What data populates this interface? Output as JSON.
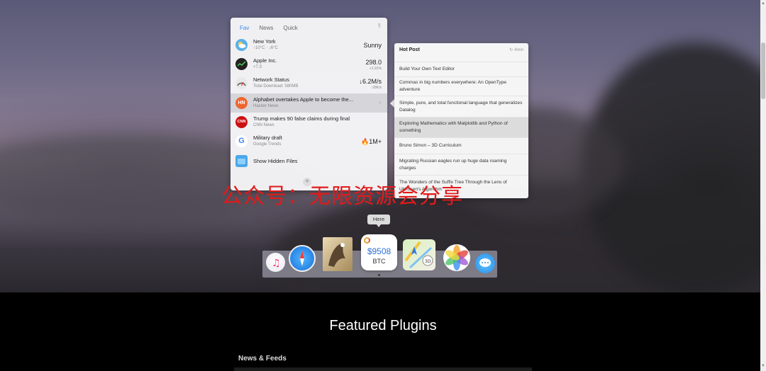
{
  "widget": {
    "tabs": [
      "Fav",
      "News",
      "Quick"
    ],
    "rows": [
      {
        "title": "New York",
        "subtitle": "↑10°C · ↓6°C",
        "value": "Sunny",
        "icon": "weather-icon"
      },
      {
        "title": "Apple Inc.",
        "subtitle": "+7.3",
        "value": "298.0",
        "value_sub": "+1.91%",
        "icon": "stock-icon"
      },
      {
        "title": "Network Status",
        "subtitle": "Total Download: 580MB",
        "value": "↓6.2M/s",
        "value_sub": "↑28K/s",
        "icon": "network-icon"
      },
      {
        "title": "Alphabet overtakes Apple to become the...",
        "subtitle": "Hacker News",
        "icon": "hacker-news-icon"
      },
      {
        "title": "Trump makes 90 false claims during final",
        "subtitle": "CNN News",
        "icon": "cnn-icon"
      },
      {
        "title": "Military draft",
        "subtitle": "Google Trends",
        "value": "🔥1M+",
        "icon": "google-icon"
      },
      {
        "title": "Show Hidden Files",
        "icon": "finder-icon"
      }
    ],
    "add_label": "+"
  },
  "hot_post": {
    "title": "Hot Post",
    "time": "4min",
    "posts": [
      "Build Your Own Text Editor",
      "Commas in big numbers everywhere: An OpenType adventure",
      "Simple, pure, and total functional language that generalizes Datalog",
      "Exploring Mathematics with Matplotlib and Python of something",
      "Bruno Simon – 3D Curriculum",
      "Migrating Russian eagles run up huge data roaming charges",
      "The Wonders of the Suffix Tree Through the Lens of Ukkonen's Algorithm"
    ]
  },
  "watermark": "公众号：无限资源会分享",
  "dock": {
    "tooltip": "Here",
    "btc_price": "$9508",
    "btc_symbol": "BTC"
  },
  "page": {
    "heading": "Featured Plugins",
    "section": "News & Feeds"
  }
}
